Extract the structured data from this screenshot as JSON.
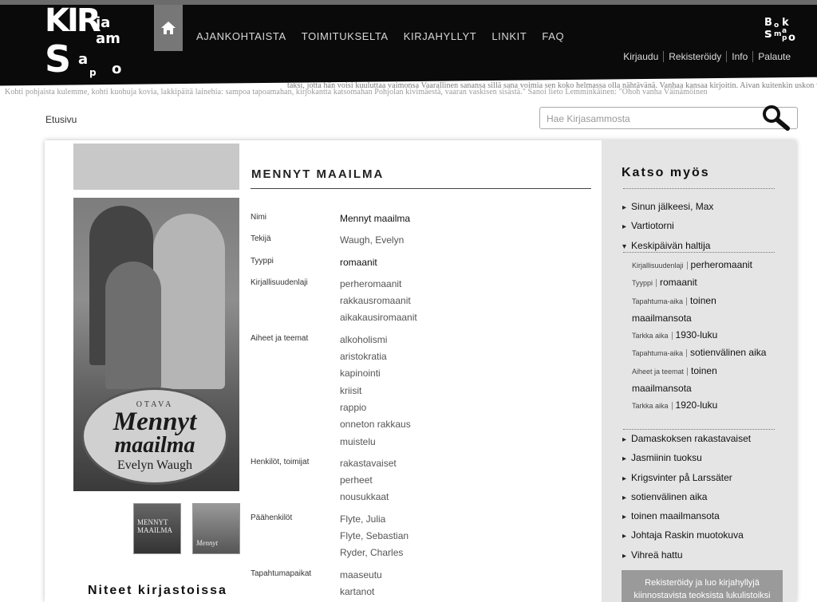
{
  "header": {
    "logo_letters": [
      "KIR",
      "ja",
      "S",
      "am",
      "a",
      "p",
      "o"
    ],
    "nav": [
      "AJANKOHTAISTA",
      "TOIMITUKSELTA",
      "KIRJAHYLLYT",
      "LINKIT",
      "FAQ"
    ],
    "brand2_letters": [
      "B",
      "o",
      "k",
      "a",
      "s",
      "m",
      "p",
      "o"
    ],
    "account": [
      "Kirjaudu",
      "Rekisteröidy",
      "Info",
      "Palaute"
    ],
    "ribbon_line1": "taksi, jotta hän voisi kuuluttaa vaimonsa Vaarallinen sanansa sillä sana voimia sen koko helmassa olla nähtävänä. Vanhaa kansaa kirjoitin. Aivan kuitenkin uskon valtaan ja Pohjolan",
    "ribbon_line2": "Kohti pohjaista kulemme, kohti kuohuja kovia, lakkipäitä lainehia: sampoa tapoamahan, kirjokantta katsomahan Pohjolan kivimäestä, vaaran vaskisen sisästä.\" Sanoi lieto Lemminkäinen: \"Ohoh vanha Väinämöinen"
  },
  "breadcrumb": "Etusivu",
  "search": {
    "placeholder": "Hae Kirjasammosta"
  },
  "book": {
    "title": "MENNYT MAAILMA",
    "cover": {
      "publisher": "OTAVA",
      "title_line1": "Mennyt",
      "title_line2": "maailma",
      "author": "Evelyn Waugh"
    },
    "thumb1_text": "MENNYT MAAILMA",
    "thumb2_text": "Mennyt",
    "fields": [
      {
        "label": "Nimi",
        "values": [
          "Mennyt maailma"
        ],
        "dark": true
      },
      {
        "label": "Tekijä",
        "values": [
          "Waugh, Evelyn"
        ],
        "dark": false
      },
      {
        "label": "Tyyppi",
        "values": [
          "romaanit"
        ],
        "dark": true
      },
      {
        "label": "Kirjallisuudenlaji",
        "values": [
          "perheromaanit",
          "rakkausromaanit",
          "aikakausiromaanit"
        ],
        "dark": false
      },
      {
        "label": "Aiheet ja teemat",
        "values": [
          "alkoholismi",
          "aristokratia",
          "kapinointi",
          "kriisit",
          "rappio",
          "onneton rakkaus",
          "muistelu"
        ],
        "dark": false
      },
      {
        "label": "Henkilöt, toimijat",
        "values": [
          "rakastavaiset",
          "perheet",
          "nousukkaat"
        ],
        "dark": false
      },
      {
        "label": "Päähenkilöt",
        "values": [
          "Flyte, Julia",
          "Flyte, Sebastian",
          "Ryder, Charles"
        ],
        "dark": false
      },
      {
        "label": "Tapahtumapaikat",
        "values": [
          "maaseutu",
          "kartanot"
        ],
        "dark": false
      }
    ],
    "holdings_title": "Niteet kirjastoissa"
  },
  "sidebar": {
    "title": "Katso myös",
    "items_top": [
      "Sinun jälkeesi, Max",
      "Vartiotorni",
      "Keskipäivän haltija"
    ],
    "expanded": [
      {
        "k": "Kirjallisuudenlaji",
        "v": "perheromaanit"
      },
      {
        "k": "Tyyppi",
        "v": "romaanit"
      },
      {
        "k": "Tapahtuma-aika",
        "v": "toinen maailmansota"
      },
      {
        "k": "Tarkka aika",
        "v": "1930-luku"
      },
      {
        "k": "Tapahtuma-aika",
        "v": "sotienvälinen aika"
      },
      {
        "k": "Aiheet ja teemat",
        "v": "toinen maailmansota"
      },
      {
        "k": "Tarkka aika",
        "v": "1920-luku"
      }
    ],
    "items_bottom": [
      "Damaskoksen rakastavaiset",
      "Jasmiinin tuoksu",
      "Krigsvinter på Larssäter",
      "sotienvälinen aika",
      "toinen maailmansota",
      "Johtaja Raskin muotokuva",
      "Vihreä hattu"
    ],
    "register_button": "Rekisteröidy ja luo kirjahyllyjä kiinnostavista teoksista lukulistoiksi"
  }
}
